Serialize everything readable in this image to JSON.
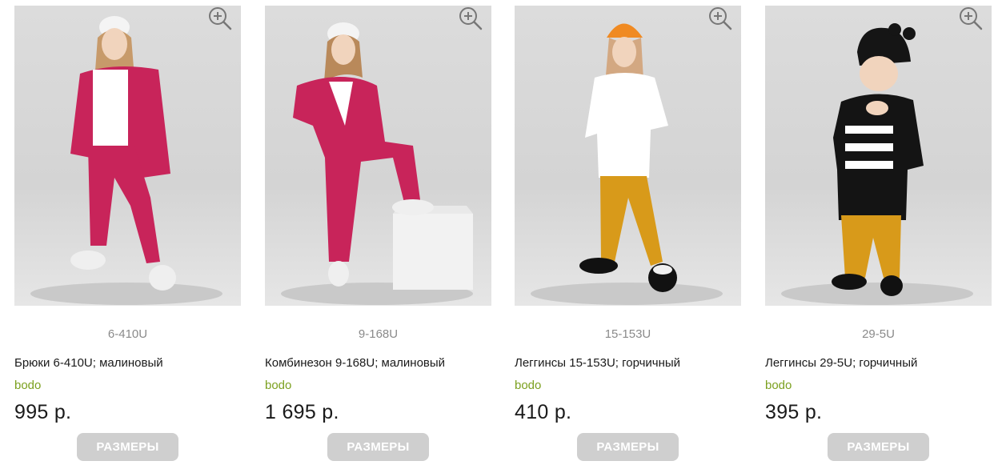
{
  "products": [
    {
      "sku": "6-410U",
      "title": "Брюки 6-410U; малиновый",
      "brand": "bodo",
      "price": "995 р.",
      "sizes_label": "РАЗМЕРЫ",
      "color": "#c8245a"
    },
    {
      "sku": "9-168U",
      "title": "Комбинезон 9-168U; малиновый",
      "brand": "bodo",
      "price": "1 695 р.",
      "sizes_label": "РАЗМЕРЫ",
      "color": "#c8245a"
    },
    {
      "sku": "15-153U",
      "title": "Леггинсы 15-153U; горчичный",
      "brand": "bodo",
      "price": "410 р.",
      "sizes_label": "РАЗМЕРЫ",
      "color": "#d89a1a"
    },
    {
      "sku": "29-5U",
      "title": "Леггинсы 29-5U; горчичный",
      "brand": "bodo",
      "price": "395 р.",
      "sizes_label": "РАЗМЕРЫ",
      "color": "#d89a1a"
    }
  ],
  "icons": {
    "zoom": "zoom-in-icon"
  }
}
